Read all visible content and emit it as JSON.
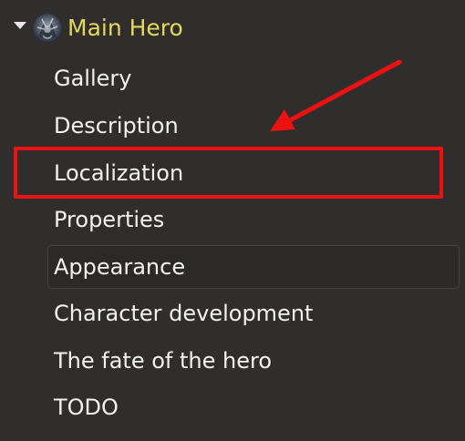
{
  "tree": {
    "expanded": true,
    "root": {
      "title": "Main Hero",
      "title_color": "#e3d75e",
      "avatar_icon": "hero-avatar"
    },
    "items": [
      {
        "label": "Gallery"
      },
      {
        "label": "Description"
      },
      {
        "label": "Localization"
      },
      {
        "label": "Properties"
      },
      {
        "label": "Appearance"
      },
      {
        "label": "Character development"
      },
      {
        "label": "The fate of the hero"
      },
      {
        "label": "TODO"
      }
    ],
    "hovered_item": "Appearance"
  },
  "annotation": {
    "highlighted_item": "Localization",
    "color": "#ee1111",
    "arrow_icon": "red-arrow"
  },
  "colors": {
    "background": "#2f2e2c",
    "text": "#f2f2f2",
    "hover_border": "#45433f"
  }
}
